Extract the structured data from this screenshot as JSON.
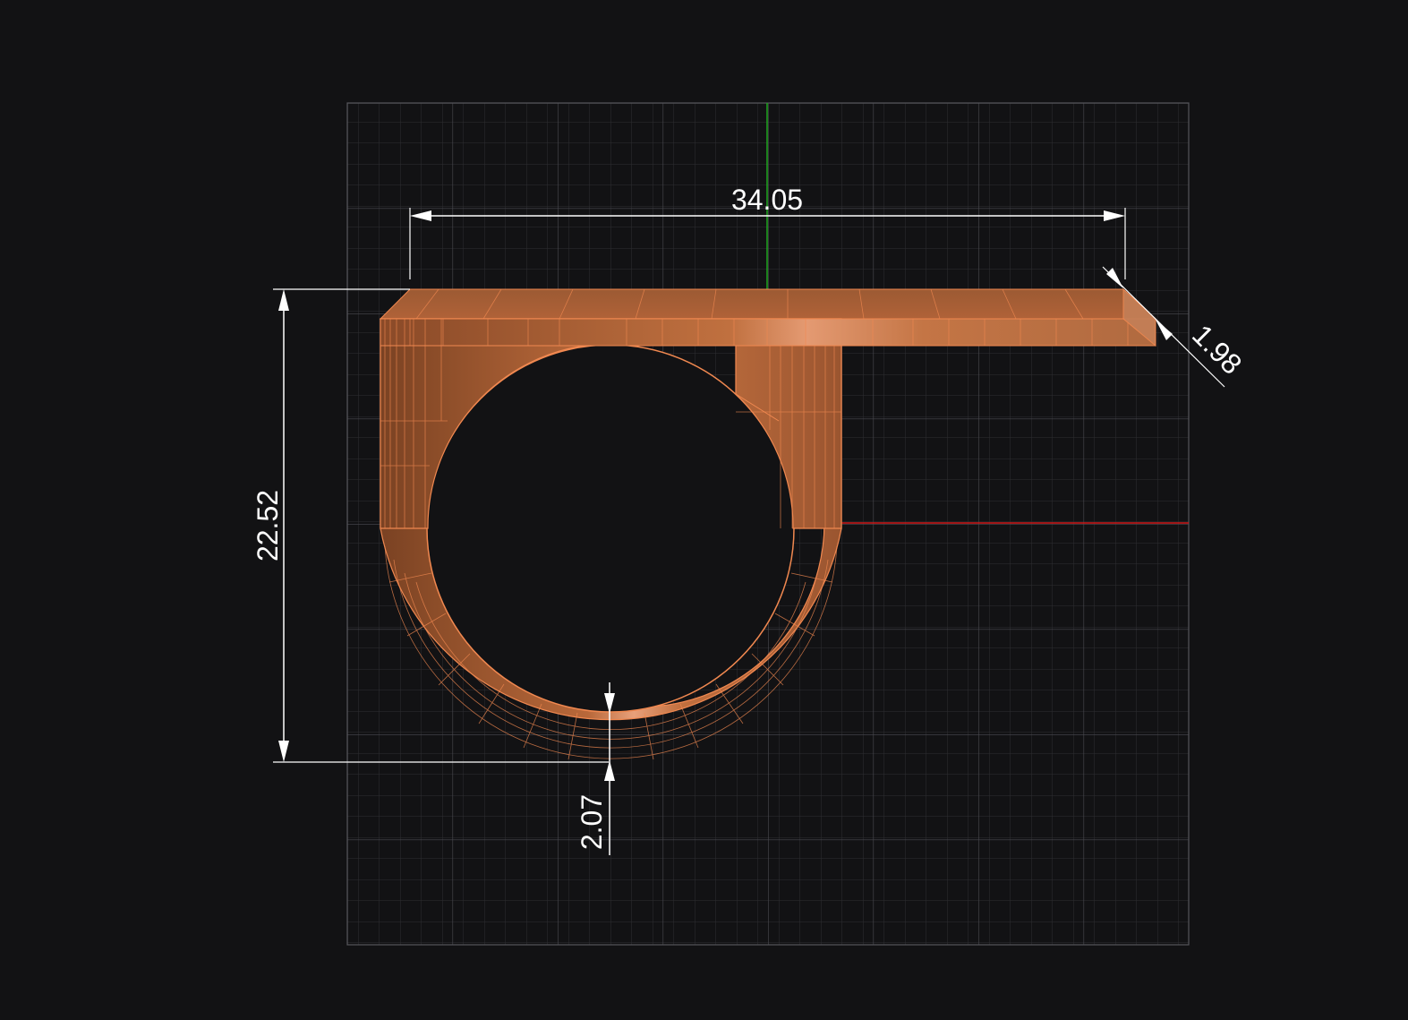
{
  "drawing": {
    "dimensions": {
      "width": "34.05",
      "height": "22.52",
      "top_thickness": "1.98",
      "band_thickness": "2.07"
    },
    "colors": {
      "background": "#121214",
      "grid_minor": "#2e2e32",
      "grid_major": "#4a4a50",
      "axis_x": "#d01818",
      "axis_y": "#1fa81f",
      "body_fill": "#b8683a",
      "body_highlight": "#e8a07a",
      "body_dark": "#7a4223",
      "wire": "#f08850",
      "dimension": "#ffffff"
    }
  }
}
